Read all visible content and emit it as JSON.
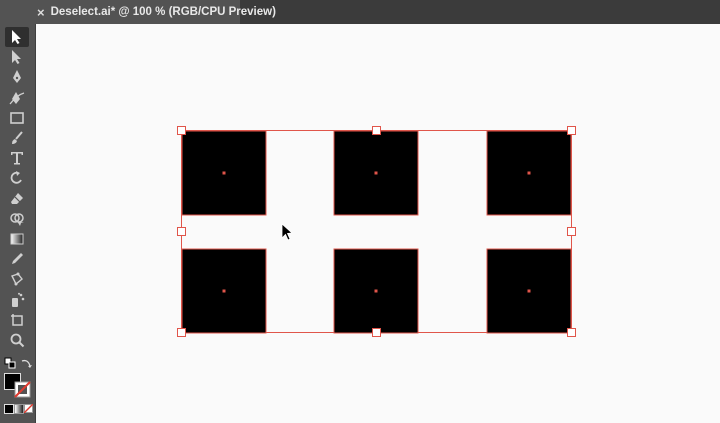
{
  "document": {
    "tab_title": "Deselect.ai* @ 100 % (RGB/CPU Preview)",
    "close_glyph": "×"
  },
  "toolbar": {
    "tools": [
      {
        "name": "selection-tool",
        "icon": "selection-arrow-icon",
        "active": true
      },
      {
        "name": "direct-selection-tool",
        "icon": "direct-selection-arrow-icon"
      },
      {
        "name": "pen-tool",
        "icon": "pen-icon"
      },
      {
        "name": "curvature-tool",
        "icon": "curvature-pen-icon"
      },
      {
        "name": "rectangle-tool",
        "icon": "rectangle-icon"
      },
      {
        "name": "paintbrush-tool",
        "icon": "paintbrush-icon"
      },
      {
        "name": "type-tool",
        "icon": "type-icon"
      },
      {
        "name": "rotate-tool",
        "icon": "rotate-icon"
      },
      {
        "name": "eraser-tool",
        "icon": "eraser-icon"
      },
      {
        "name": "shape-builder-tool",
        "icon": "shape-builder-icon"
      },
      {
        "name": "gradient-tool",
        "icon": "gradient-icon"
      },
      {
        "name": "eyedropper-tool",
        "icon": "eyedropper-icon"
      },
      {
        "name": "puppet-warp-tool",
        "icon": "puppet-warp-icon"
      },
      {
        "name": "symbol-sprayer-tool",
        "icon": "symbol-sprayer-icon"
      },
      {
        "name": "artboard-tool",
        "icon": "artboard-icon"
      },
      {
        "name": "zoom-tool",
        "icon": "magnifier-icon"
      }
    ],
    "fill_color": "#000000",
    "stroke_color": "none"
  },
  "artwork": {
    "shape_fill": "#000000",
    "selection_color": "#e0554a",
    "squares": 6,
    "selected": true
  },
  "colors": {
    "panel": "#535353",
    "canvas": "#fafafa",
    "tab_bg": "#535353",
    "tabbar_bg": "#3b3b3b"
  }
}
